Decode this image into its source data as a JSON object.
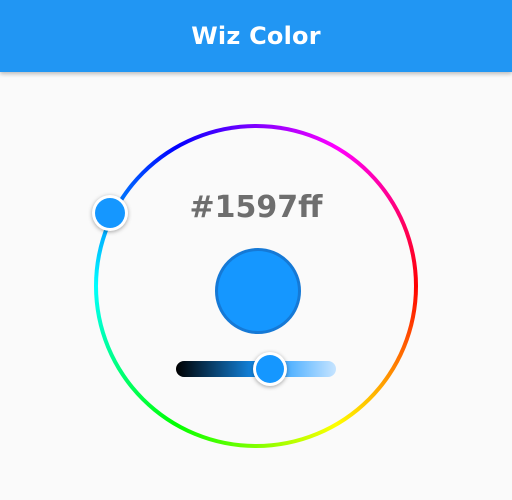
{
  "app_bar": {
    "title": "Wiz Color"
  },
  "picker": {
    "hex_value": "#1597ff",
    "selected_color": "#1597ff",
    "brightness_level": 0.55
  },
  "colors": {
    "app_bar": "#2196f3",
    "background": "#fafafa",
    "hex_text": "#6e6e6e",
    "swatch_border": "#1579d6",
    "slider_start": "#000000",
    "slider_end": "#c6e4ff"
  }
}
